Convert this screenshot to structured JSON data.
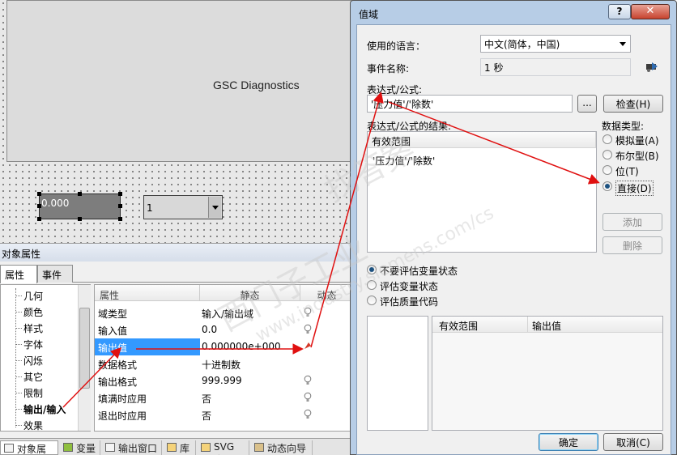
{
  "canvas": {
    "diag_title": "GSC Diagnostics",
    "io_field_value": "0.000",
    "combo_value": "1"
  },
  "properties": {
    "header": "对象属性",
    "tabs": [
      "属性",
      "事件"
    ],
    "tree": [
      "几何",
      "颜色",
      "样式",
      "字体",
      "闪烁",
      "其它",
      "限制",
      "输出/输入",
      "效果"
    ],
    "grid_headers": [
      "属性",
      "静态",
      "动态"
    ],
    "rows": [
      {
        "name": "域类型",
        "value": "输入/输出域"
      },
      {
        "name": "输入值",
        "value": "0.0"
      },
      {
        "name": "输出值",
        "value": "0.000000e+000"
      },
      {
        "name": "数据格式",
        "value": "十进制数"
      },
      {
        "name": "输出格式",
        "value": "999.999"
      },
      {
        "name": "填满时应用",
        "value": "否"
      },
      {
        "name": "退出时应用",
        "value": "否"
      }
    ]
  },
  "bottom_tabs": [
    "对象属性",
    "变量",
    "输出窗口",
    "库",
    "SVG 库",
    "动态向导"
  ],
  "dialog": {
    "title": "值域",
    "help": "?",
    "close": "✕",
    "language_label": "使用的语言：",
    "language_value": "中文(简体，中国)",
    "event_label": "事件名称:",
    "event_value": "1 秒",
    "expr_label": "表达式/公式:",
    "expr_value": "'压力值'/'除数'",
    "browse_button": "...",
    "check_button": "检查(H)",
    "result_label": "表达式/公式的结果:",
    "result_header": "有效范围",
    "result_row": "'压力值'/'除数'",
    "datatype_label": "数据类型:",
    "datatypes": [
      "模拟量(A)",
      "布尔型(B)",
      "位(T)",
      "直接(D)"
    ],
    "add_button": "添加",
    "delete_button": "删除",
    "eval_options": [
      "不要评估变量状态",
      "评估变量状态",
      "评估质量代码"
    ],
    "lower_headers": [
      "有效范围",
      "输出值"
    ],
    "ok_button": "确定",
    "cancel_button": "取消(C)"
  },
  "watermark": {
    "line1": "西门子工业",
    "line2": "找答案",
    "line3": "www.industry.siemens.com/cs"
  },
  "colors": {
    "annotation_arrow": "#e01010",
    "selection": "#3399ff",
    "dialog_frame": "#b7cde6"
  }
}
